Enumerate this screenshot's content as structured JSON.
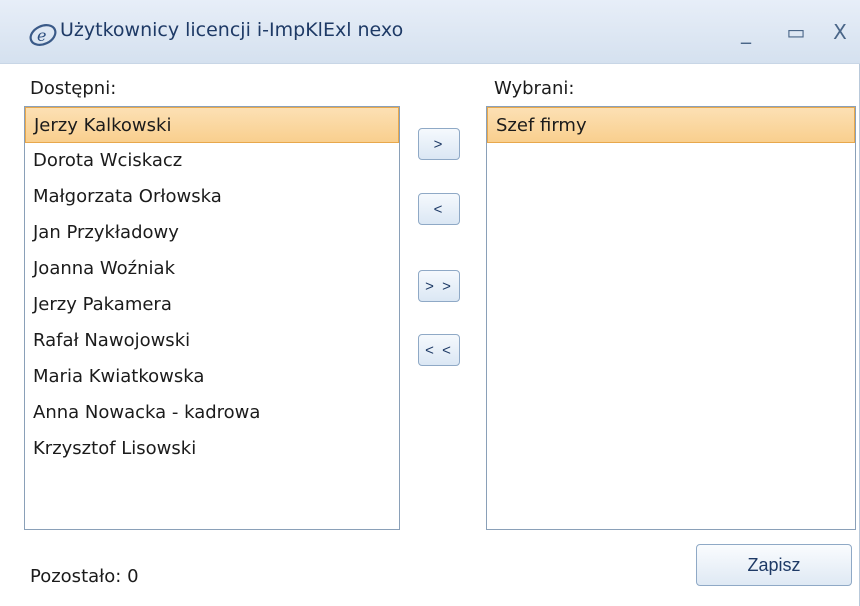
{
  "window": {
    "title": "Użytkownicy licencji i-ImpKlExl nexo",
    "controls": {
      "minimize": "_",
      "maximize": "▭",
      "close": "X"
    }
  },
  "available": {
    "label": "Dostępni:",
    "items": [
      "Jerzy Kalkowski",
      "Dorota Wciskacz",
      "Małgorzata Orłowska",
      "Jan Przykładowy",
      "Joanna Woźniak",
      "Jerzy Pakamera",
      "Rafał Nawojowski",
      "Maria Kwiatkowska",
      "Anna Nowacka - kadrowa",
      "Krzysztof Lisowski"
    ],
    "selected_index": 0
  },
  "chosen": {
    "label": "Wybrani:",
    "items": [
      "Szef firmy"
    ],
    "selected_index": 0
  },
  "buttons": {
    "add_one": ">",
    "remove_one": "<",
    "add_all": "> >",
    "remove_all": "< <",
    "save": "Zapisz"
  },
  "status": {
    "remaining": "Pozostało: 0"
  },
  "colors": {
    "selection": "#f9cf8e",
    "selection_border": "#e8a84c",
    "titlebar": "#dbe5f1",
    "title_text": "#1e3a66"
  },
  "icons": {
    "app": "app-logo-icon"
  }
}
